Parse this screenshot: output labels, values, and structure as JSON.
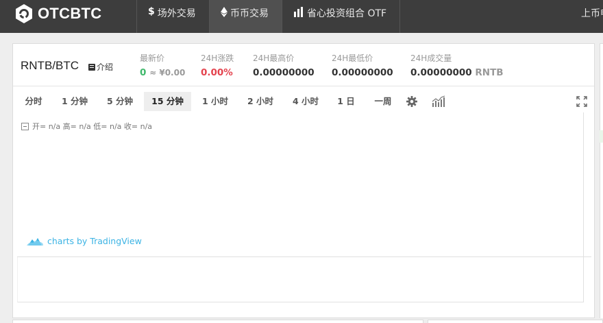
{
  "nav": {
    "logo_text": "OTCBTC",
    "items": [
      {
        "icon": "$",
        "label": "场外交易"
      },
      {
        "icon": "♦",
        "label": "币币交易"
      },
      {
        "icon": "▮",
        "label": "省心投资组合 OTF"
      }
    ],
    "right_label": "上币申请"
  },
  "ticker": {
    "pair": "RNTB/BTC",
    "intro_label": "介绍",
    "latest_label": "最新价",
    "latest_value": "0",
    "latest_cny": "≈ ¥0.00",
    "change_label": "24H涨跌",
    "change_value": "0.00%",
    "high_label": "24H最高价",
    "high_value": "0.00000000",
    "low_label": "24H最低价",
    "low_value": "0.00000000",
    "volume_label": "24H成交量",
    "volume_value": "0.00000000",
    "volume_unit": "RNTB"
  },
  "toolbar": {
    "timeframes": [
      "分时",
      "1 分钟",
      "5 分钟",
      "15 分钟",
      "1 小时",
      "2 小时",
      "4 小时",
      "1 日",
      "一周"
    ],
    "active_index": 3
  },
  "chart": {
    "legend": "开= n/a 高= n/a 低= n/a 收= n/a",
    "brand": "charts by TradingView"
  },
  "colors": {
    "nav_bg": "#3d3d3d",
    "up": "#3fb86b",
    "down": "#e4434e",
    "brand": "#3bb3e4"
  }
}
